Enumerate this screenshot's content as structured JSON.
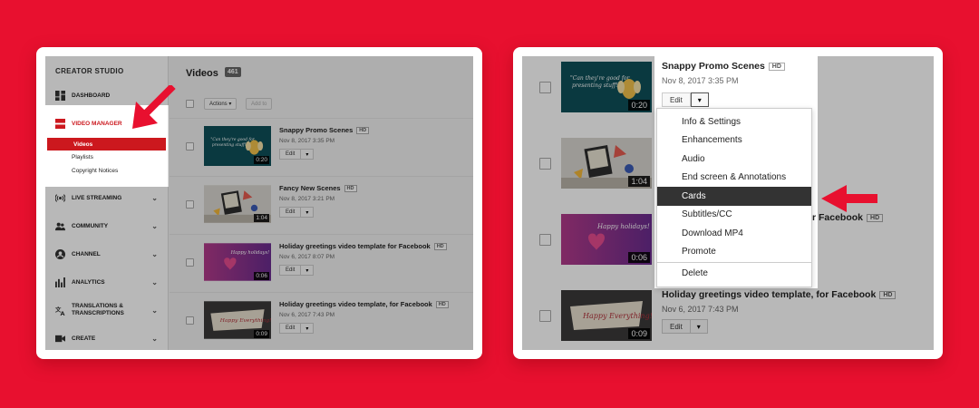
{
  "left": {
    "sidebar": {
      "title": "CREATOR STUDIO",
      "items": [
        {
          "label": "DASHBOARD"
        },
        {
          "label": "VIDEO MANAGER"
        },
        {
          "label": "LIVE STREAMING"
        },
        {
          "label": "COMMUNITY"
        },
        {
          "label": "CHANNEL"
        },
        {
          "label": "ANALYTICS"
        },
        {
          "label": "TRANSLATIONS &",
          "label2": "TRANSCRIPTIONS"
        },
        {
          "label": "CREATE"
        }
      ],
      "subitems": [
        {
          "label": "Videos"
        },
        {
          "label": "Playlists"
        },
        {
          "label": "Copyright Notices"
        }
      ]
    },
    "main": {
      "title": "Videos",
      "count": "461",
      "actions_label": "Actions",
      "add_to_label": "Add to"
    }
  },
  "videos": [
    {
      "title": "Snappy Promo Scenes",
      "date": "Nov 8, 2017 3:35 PM",
      "duration": "0:20",
      "hd": "HD",
      "thumb_text": "\"Can they're good for presenting stuff!\""
    },
    {
      "title": "Fancy New Scenes",
      "date": "Nov 8, 2017 3:21 PM",
      "duration": "1:04",
      "hd": "HD"
    },
    {
      "title": "Holiday greetings video template for Facebook",
      "date": "Nov 6, 2017 8:07 PM",
      "duration": "0:06",
      "hd": "HD",
      "thumb_text": "Happy holidays!"
    },
    {
      "title": "Holiday greetings video template, for Facebook",
      "date": "Nov 6, 2017 7:43 PM",
      "duration": "0:09",
      "hd": "HD",
      "thumb_text": "Happy Everything!"
    }
  ],
  "common": {
    "edit_label": "Edit",
    "dropdown_glyph": "▾",
    "chevron": "⌄"
  },
  "right": {
    "menu": [
      {
        "label": "Info & Settings"
      },
      {
        "label": "Enhancements"
      },
      {
        "label": "Audio"
      },
      {
        "label": "End screen & Annotations"
      },
      {
        "label": "Cards"
      },
      {
        "label": "Subtitles/CC"
      },
      {
        "label": "Download MP4"
      },
      {
        "label": "Promote"
      },
      {
        "label": "Delete"
      }
    ],
    "partial_title_row3": "r Facebook"
  },
  "colors": {
    "background": "#e8102f",
    "accent": "#cc181e",
    "arrow": "#e8102f"
  }
}
